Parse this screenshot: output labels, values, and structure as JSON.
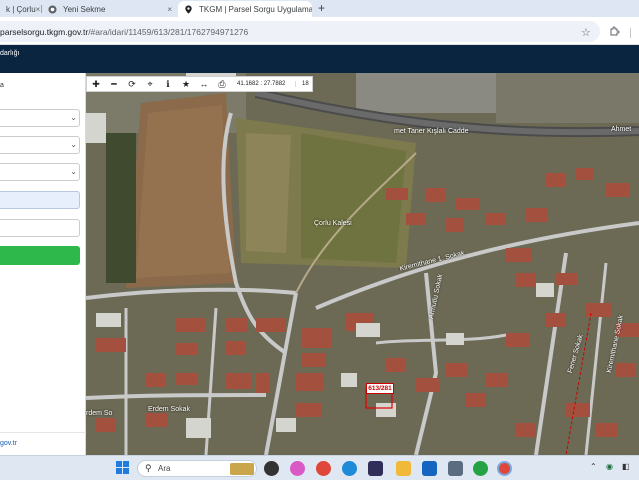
{
  "browser": {
    "tabs": [
      {
        "title": "k | Çorlu",
        "active": false
      },
      {
        "title": "Yeni Sekme",
        "active": false
      },
      {
        "title": "TKGM | Parsel Sorgu Uygulama",
        "active": true
      }
    ],
    "new_tab_label": "+",
    "close_glyph": "×",
    "url_host": "parselsorgu.tkgm.gov.tr",
    "url_path": "/#ara/idari/11459/613/281/1762794971276"
  },
  "site": {
    "header_text": "darlığı"
  },
  "left_panel": {
    "label": "a"
  },
  "map": {
    "toolbar": {
      "coords": "41.1682 : 27.7882",
      "zoom": "18"
    },
    "labels": {
      "street_top": "met Taner Kışlalı Cadde",
      "street_top_right": "Ahmet",
      "castle": "Çorlu Kalesi",
      "kiremithane1": "Kiremithane 1. Sokak",
      "armutlu": "Armutlu Sokak",
      "kiremithane2": "Kiremithane Sokak",
      "erdem": "Erdem Sokak",
      "erdem_left": "rdem So",
      "fener": "Fener Sokak",
      "parcel": "613/281"
    }
  },
  "footer": {
    "link": "gov.tr"
  },
  "taskbar": {
    "search_placeholder": "Ara"
  }
}
